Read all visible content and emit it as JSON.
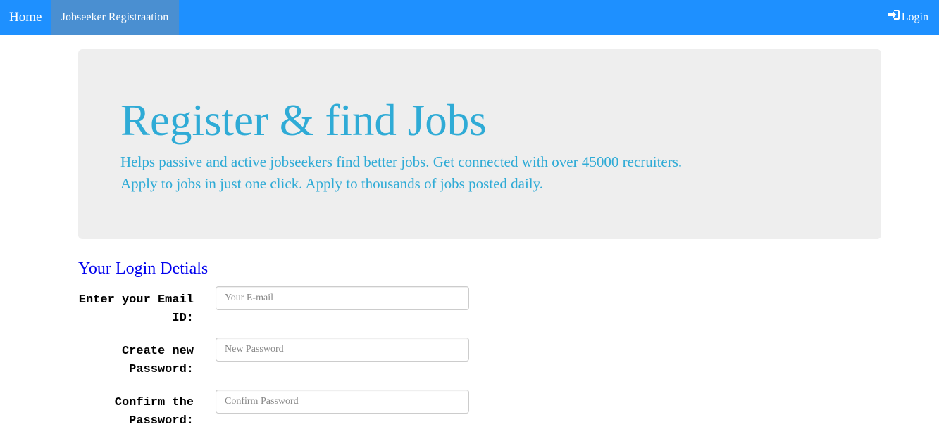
{
  "nav": {
    "home_label": "Home",
    "active_label": "Jobseeker Registraation",
    "login_label": "Login",
    "login_icon": "log-in-icon"
  },
  "jumbotron": {
    "title": "Register & find Jobs",
    "line1": "Helps passive and active jobseekers find better jobs. Get connected with over 45000 recruiters.",
    "line2": "Apply to jobs in just one click. Apply to thousands of jobs posted daily."
  },
  "form": {
    "section_title": "Your Login Detials",
    "fields": [
      {
        "label_line1": "Enter your Email",
        "label_line2": "ID:",
        "placeholder": "Your E-mail"
      },
      {
        "label_line1": "Create new",
        "label_line2": "Password:",
        "placeholder": "New Password"
      },
      {
        "label_line1": "Confirm the",
        "label_line2": "Password:",
        "placeholder": "Confirm Password"
      }
    ]
  },
  "colors": {
    "navbar": "#1e90ff",
    "active_tab": "#4a8fd1",
    "jumbotron_bg": "#eeeeee",
    "jumbotron_text": "#2fabd6",
    "section_title": "#0000ee"
  }
}
